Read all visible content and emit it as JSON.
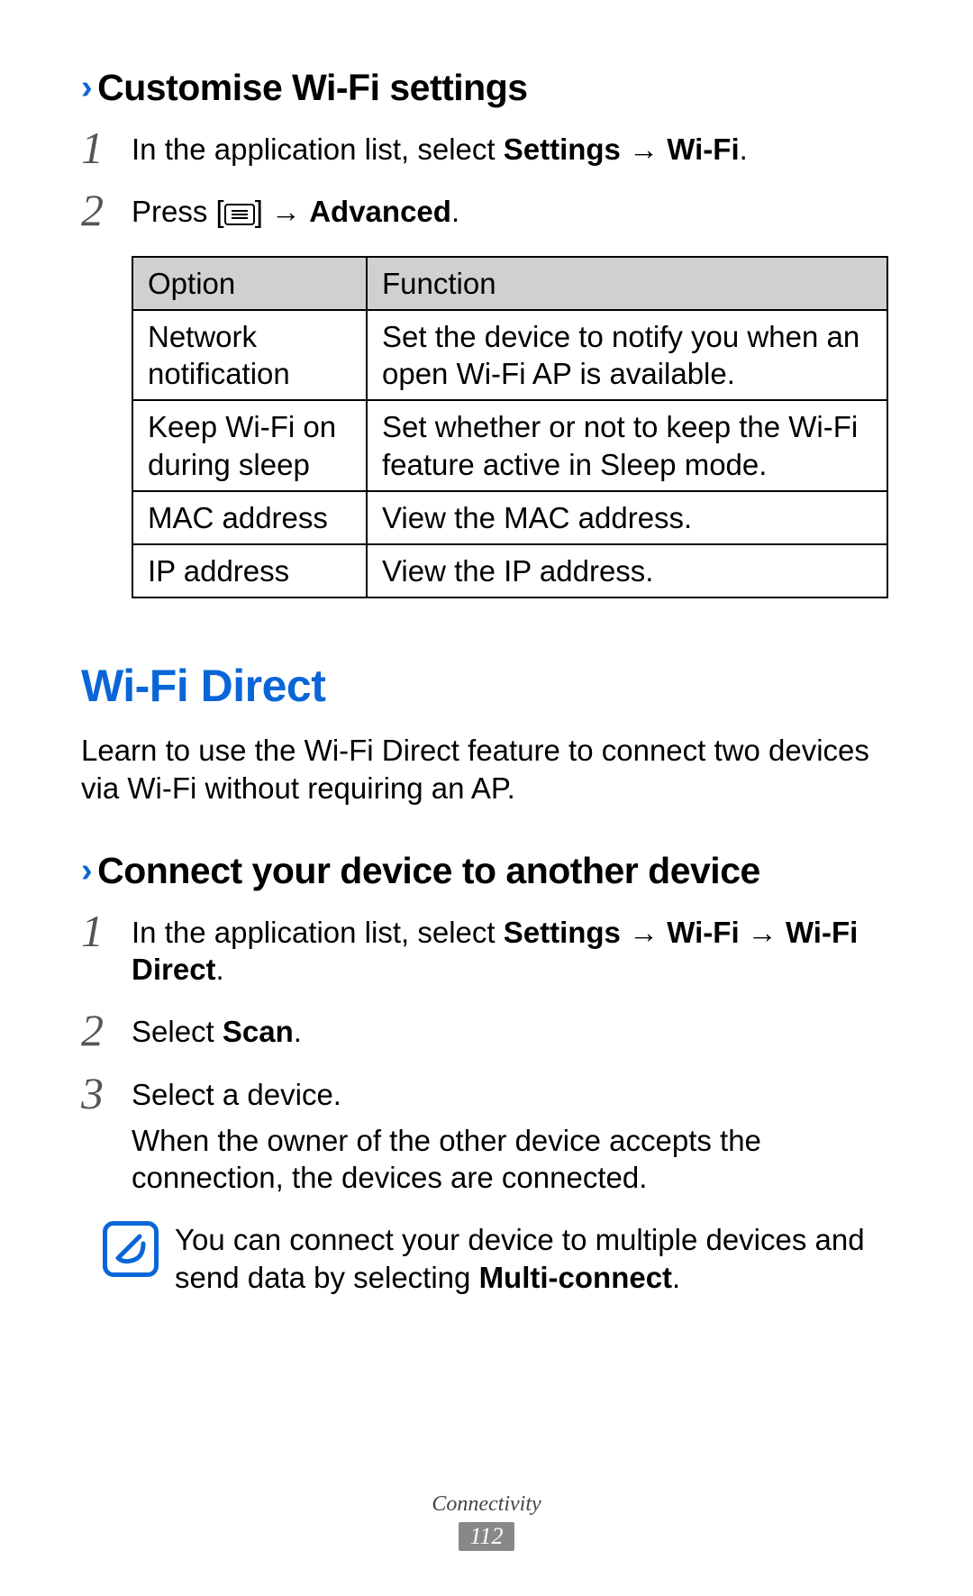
{
  "headings": {
    "customise": "Customise Wi-Fi settings",
    "wifi_direct": "Wi-Fi Direct",
    "connect_device": "Connect your device to another device"
  },
  "steps_customise": {
    "s1_pre": "In the application list, select ",
    "s1_b1": "Settings",
    "s1_arrow": " → ",
    "s1_b2": "Wi-Fi",
    "s1_post": ".",
    "s2_pre": "Press [",
    "s2_post": "] → ",
    "s2_b": "Advanced",
    "s2_end": "."
  },
  "table": {
    "header_option": "Option",
    "header_function": "Function",
    "rows": [
      {
        "option": "Network notification",
        "func": "Set the device to notify you when an open Wi-Fi AP is available."
      },
      {
        "option": "Keep Wi-Fi on during sleep",
        "func": "Set whether or not to keep the Wi-Fi feature active in Sleep mode."
      },
      {
        "option": "MAC address",
        "func": "View the MAC address."
      },
      {
        "option": "IP address",
        "func": "View the IP address."
      }
    ]
  },
  "intro_direct": "Learn to use the Wi-Fi Direct feature to connect two devices via Wi-Fi without requiring an AP.",
  "steps_connect": {
    "s1_pre": "In the application list, select ",
    "s1_b1": "Settings",
    "s1_arrow1": " → ",
    "s1_b2": "Wi-Fi",
    "s1_arrow2": " → ",
    "s1_b3": "Wi-Fi Direct",
    "s1_end": ".",
    "s2_pre": "Select ",
    "s2_b": "Scan",
    "s2_end": ".",
    "s3_line": "Select a device.",
    "s3_follow": "When the owner of the other device accepts the connection, the devices are connected."
  },
  "note": {
    "pre": "You can connect your device to multiple devices and send data by selecting ",
    "b": "Multi-connect",
    "end": "."
  },
  "footer": {
    "section": "Connectivity",
    "page": "112"
  }
}
